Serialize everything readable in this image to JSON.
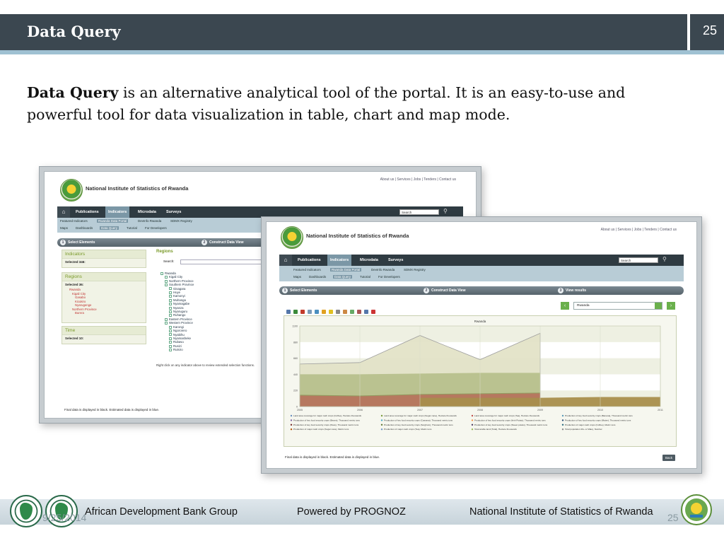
{
  "slide": {
    "title": "Data Query",
    "number": "25",
    "intro_bold": "Data Query",
    "intro_rest": " is an alternative analytical tool of the portal. It is an easy-to-use and  powerful tool for data visualization in table, chart and map mode."
  },
  "portal": {
    "top_links": "About us  |  Services  |  Jobs  |  Tenders  |  Contact us",
    "brand": "National Institute of Statistics of Rwanda",
    "nav": [
      "Publications",
      "Indicators",
      "Microdata",
      "Surveys"
    ],
    "search_value": "Search",
    "subnav_row1": [
      "Featured Indicators",
      "Rwanda Data Portal",
      "DevInfo Rwanda",
      "SDMX Registry"
    ],
    "subnav_row2": [
      "Maps",
      "Dashboards",
      "Data Query",
      "Tutorial",
      "For Developers"
    ],
    "steps": [
      "Select Elements",
      "Construct Data View",
      "View results"
    ],
    "footer_note": "Final data is displayed in black. Estimated data is displayed in blue."
  },
  "selector": {
    "indicators_title": "Indicators",
    "indicators_selected": "Selected 346:",
    "regions_title": "Regions",
    "regions_selected": "Selected 36:",
    "region_list": [
      "Rwanda",
      "Kigali City",
      "Gasabo",
      "Kicukiro",
      "Nyarugenge",
      "Northern Province",
      "Burera"
    ],
    "time_title": "Time",
    "time_selected": "Selected 10:",
    "tree_title": "Regions",
    "search_label": "Search:",
    "tree": [
      "Rwanda",
      "Kigali City",
      "Northern Province",
      "Southern Province",
      "Gisagara",
      "Huye",
      "Kamonyi",
      "Muhanga",
      "Nyamagabe",
      "Nyanza",
      "Nyaruguru",
      "Ruhango",
      "Eastern Province",
      "Western Province",
      "Karongi",
      "Ngororero",
      "Nyabihu",
      "Nyamasheke",
      "Rubavu",
      "Rusizi",
      "Rutsiro"
    ],
    "hint": "Right click on any indicator above to review extended selection functions."
  },
  "results": {
    "region": "Rwanda",
    "back_label": "Back"
  },
  "chart_data": {
    "type": "area",
    "title": "Rwanda",
    "x": [
      "2005",
      "2006",
      "2007",
      "2008",
      "2009",
      "2010",
      "2011"
    ],
    "yticks": [
      "0",
      "220",
      "440",
      "660",
      "880",
      "1100"
    ],
    "ylim": [
      0,
      1100
    ],
    "series": [
      {
        "name": "Land area coverage for major cash crops (Coffee), Hectare thousands",
        "color": "#e3e3c8",
        "values": [
          580,
          600,
          970,
          640,
          1000,
          null,
          null
        ]
      },
      {
        "name": "Land area coverage for major cash crops (Sugar cane), Hectare thousands",
        "color": "#b7c08c",
        "values": [
          440,
          440,
          450,
          460,
          460,
          null,
          null
        ]
      },
      {
        "name": "Production of key food security crops (Cassava), Thousand metric tons",
        "color": "#8f9a5e",
        "values": [
          160,
          150,
          170,
          180,
          190,
          null,
          null
        ]
      },
      {
        "name": "Land area coverage for major cash crops (Tea), Hectare thousands",
        "color": "#b8765f",
        "values": [
          150,
          140,
          160,
          170,
          180,
          null,
          null
        ]
      },
      {
        "name": "Production of key food security crops (Irish Potato), Thousand metric tons",
        "color": "#a88e4c",
        "values": [
          null,
          null,
          120,
          120,
          120,
          130,
          130
        ]
      }
    ],
    "legend": [
      "Land area coverage for major cash crops (Coffee), Hectare thousands",
      "Land area coverage for major cash crops (Sugar cane), Hectare thousands",
      "Land area coverage for major cash crops (Tea), Hectare thousands",
      "Production of key food security crops (Banana), Thousand metric tons",
      "Production of key food security crops (Beans), Thousand metric tons",
      "Production of key food security crops (Cassava), Thousand metric tons",
      "Production of key food security crops (Irish Potato), Thousand metric tons",
      "Production of key food security crops (Maize), Thousand metric tons",
      "Production of key food security crops (Peas), Thousand metric tons",
      "Production of key food security crops (Sorghum), Thousand metric tons",
      "Production of key food security crops (Sweet potato), Thousand metric tons",
      "Production of major cash crops (Coffee), Metric tons",
      "Production of major cash crops (Sugar cane), Metric tons",
      "Production of major cash crops (Tea), Metric tons",
      "Total arable land (Total), Hectare thousands",
      "Total population 20+ or Male), Number"
    ]
  },
  "footer": {
    "left": "African Development Bank Group",
    "middle": "Powered by PROGNOZ",
    "right": "National Institute of Statistics of Rwanda",
    "date": "9/25/2014",
    "page": "25"
  },
  "colors": {
    "header_bg": "#3b4750",
    "accent_green": "#6ab04c",
    "nav_dark": "#2f3b42"
  }
}
